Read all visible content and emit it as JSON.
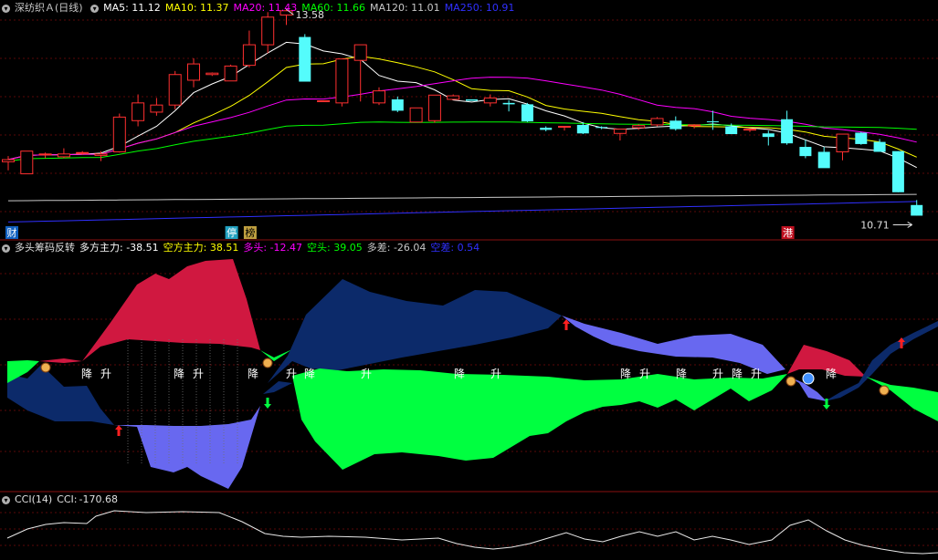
{
  "main_panel": {
    "stock_name": "深纺织Ａ",
    "period": "(日线)",
    "ma_values": [
      {
        "label": "MA5:",
        "value": "11.12",
        "color": "#ffffff"
      },
      {
        "label": "MA10:",
        "value": "11.37",
        "color": "#ffff00"
      },
      {
        "label": "MA20:",
        "value": "11.43",
        "color": "#ff00ff"
      },
      {
        "label": "MA60:",
        "value": "11.66",
        "color": "#00ff00"
      },
      {
        "label": "MA120:",
        "value": "11.01",
        "color": "#c8c8c8"
      },
      {
        "label": "MA250:",
        "value": "10.91",
        "color": "#3030ff"
      }
    ],
    "high_label": "13.58",
    "low_label": "10.71",
    "badges": [
      {
        "text": "财",
        "bar": 1,
        "bg": "#1060c0",
        "fg": "#ffffff"
      },
      {
        "text": "停",
        "bar": 12,
        "bg": "#20a0c0",
        "fg": "#ffffff"
      },
      {
        "text": "榜",
        "bar": 13,
        "bg": "#c0a040",
        "fg": "#000000"
      },
      {
        "text": "港",
        "bar": 42,
        "bg": "#c01020",
        "fg": "#ffffff"
      }
    ]
  },
  "indicator_panel": {
    "name": "多头筹码反转",
    "values": [
      {
        "label": "多方主力:",
        "value": "-38.51",
        "color": "#ffffff"
      },
      {
        "label": "空方主力:",
        "value": "38.51",
        "color": "#ffff00"
      },
      {
        "label": "多头:",
        "value": "-12.47",
        "color": "#ff00ff"
      },
      {
        "label": "空头:",
        "value": "39.05",
        "color": "#00ff00"
      },
      {
        "label": "多差:",
        "value": "-26.04",
        "color": "#c8c8c8"
      },
      {
        "label": "空差:",
        "value": "0.54",
        "color": "#3030ff"
      }
    ],
    "signal_labels": [
      {
        "text": "降",
        "x": 95
      },
      {
        "text": "升",
        "x": 116
      },
      {
        "text": "降",
        "x": 196
      },
      {
        "text": "升",
        "x": 217
      },
      {
        "text": "降",
        "x": 277
      },
      {
        "text": "升",
        "x": 319
      },
      {
        "text": "降",
        "x": 339
      },
      {
        "text": "升",
        "x": 401
      },
      {
        "text": "降",
        "x": 503
      },
      {
        "text": "升",
        "x": 543
      },
      {
        "text": "降",
        "x": 685
      },
      {
        "text": "升",
        "x": 706
      },
      {
        "text": "降",
        "x": 746
      },
      {
        "text": "升",
        "x": 786
      },
      {
        "text": "降",
        "x": 807
      },
      {
        "text": "升",
        "x": 828
      },
      {
        "text": "降",
        "x": 910
      }
    ]
  },
  "cci_panel": {
    "name": "CCI(14)",
    "label": "CCI:",
    "value": "-170.68"
  },
  "chart_data": {
    "type": "candlestick",
    "bars": 50,
    "y_range": [
      10.6,
      13.7
    ],
    "up_color": "#ff3030",
    "down_color": "#54fcfc",
    "candles": [
      [
        11.47,
        11.55,
        11.35,
        11.5
      ],
      [
        11.3,
        11.3,
        11.62,
        11.62
      ],
      [
        11.58,
        11.6,
        11.52,
        11.58
      ],
      [
        11.54,
        11.66,
        11.52,
        11.58
      ],
      [
        11.6,
        11.62,
        11.57,
        11.6
      ],
      [
        11.56,
        11.62,
        11.48,
        11.58
      ],
      [
        11.61,
        12.15,
        11.6,
        12.1
      ],
      [
        12.05,
        12.42,
        11.97,
        12.3
      ],
      [
        12.17,
        12.37,
        12.12,
        12.27
      ],
      [
        12.27,
        12.75,
        12.21,
        12.7
      ],
      [
        12.62,
        12.93,
        12.52,
        12.85
      ],
      [
        12.7,
        12.73,
        12.68,
        12.72
      ],
      [
        12.61,
        12.84,
        12.65,
        12.82
      ],
      [
        12.83,
        13.32,
        12.8,
        13.12
      ],
      [
        13.12,
        13.58,
        13.0,
        13.51
      ],
      [
        13.54,
        13.62,
        13.4,
        13.6
      ],
      [
        13.23,
        13.27,
        12.62,
        12.6
      ],
      [
        12.33,
        12.33,
        12.33,
        12.33
      ],
      [
        12.3,
        12.92,
        12.25,
        12.92
      ],
      [
        12.9,
        13.12,
        12.32,
        13.12
      ],
      [
        12.3,
        12.52,
        12.27,
        12.47
      ],
      [
        12.35,
        12.39,
        12.17,
        12.19
      ],
      [
        12.03,
        12.23,
        12.03,
        12.23
      ],
      [
        12.05,
        12.41,
        12.02,
        12.41
      ],
      [
        12.35,
        12.42,
        12.35,
        12.4
      ],
      [
        12.35,
        12.35,
        12.33,
        12.33
      ],
      [
        12.3,
        12.42,
        12.25,
        12.37
      ],
      [
        12.3,
        12.34,
        12.18,
        12.28
      ],
      [
        12.28,
        12.3,
        12.03,
        12.04
      ],
      [
        11.95,
        11.97,
        11.9,
        11.92
      ],
      [
        11.97,
        11.97,
        11.91,
        11.97
      ],
      [
        11.99,
        12.03,
        11.86,
        11.87
      ],
      [
        11.96,
        11.97,
        11.93,
        11.95
      ],
      [
        11.87,
        11.93,
        11.77,
        11.93
      ],
      [
        11.95,
        12.0,
        11.92,
        11.98
      ],
      [
        11.99,
        12.1,
        11.97,
        12.08
      ],
      [
        12.05,
        12.11,
        11.91,
        11.93
      ],
      [
        11.98,
        12.0,
        11.94,
        11.99
      ],
      [
        12.04,
        12.19,
        11.92,
        12.03
      ],
      [
        11.97,
        12.01,
        11.86,
        11.86
      ],
      [
        11.93,
        11.94,
        11.89,
        11.93
      ],
      [
        11.87,
        11.91,
        11.7,
        11.82
      ],
      [
        12.07,
        12.19,
        11.71,
        11.73
      ],
      [
        11.68,
        11.78,
        11.52,
        11.55
      ],
      [
        11.61,
        11.68,
        11.41,
        11.38
      ],
      [
        11.61,
        11.84,
        11.49,
        11.86
      ],
      [
        11.88,
        11.89,
        11.71,
        11.72
      ],
      [
        11.75,
        11.79,
        11.65,
        11.61
      ],
      [
        11.62,
        11.62,
        11.04,
        11.04
      ],
      [
        10.86,
        10.93,
        10.71,
        10.71
      ]
    ]
  }
}
